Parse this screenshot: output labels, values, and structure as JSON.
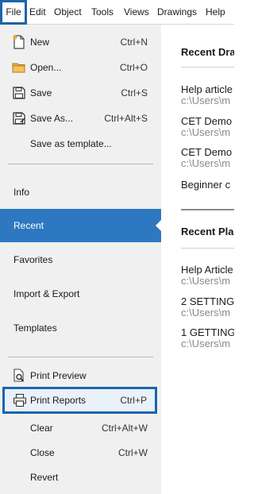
{
  "menubar": {
    "items": [
      "File",
      "Edit",
      "Object",
      "Tools",
      "Views",
      "Drawings",
      "Help"
    ]
  },
  "file_menu": {
    "new": {
      "label": "New",
      "shortcut": "Ctrl+N",
      "icon": "new-file-icon"
    },
    "open": {
      "label": "Open...",
      "shortcut": "Ctrl+O",
      "icon": "folder-icon"
    },
    "save": {
      "label": "Save",
      "shortcut": "Ctrl+S",
      "icon": "save-icon"
    },
    "save_as": {
      "label": "Save As...",
      "shortcut": "Ctrl+Alt+S",
      "icon": "save-as-icon"
    },
    "save_template": {
      "label": "Save as template..."
    },
    "nav": {
      "info": "Info",
      "recent": "Recent",
      "favorites": "Favorites",
      "import_export": "Import & Export",
      "templates": "Templates"
    },
    "print_preview": {
      "label": "Print Preview",
      "icon": "print-preview-icon"
    },
    "print_reports": {
      "label": "Print Reports",
      "shortcut": "Ctrl+P",
      "icon": "printer-icon"
    },
    "clear": {
      "label": "Clear",
      "shortcut": "Ctrl+Alt+W"
    },
    "close": {
      "label": "Close",
      "shortcut": "Ctrl+W"
    },
    "revert": {
      "label": "Revert"
    }
  },
  "recent": {
    "drawings_header": "Recent Dra",
    "drawings": [
      {
        "title": "Help article",
        "path": "c:\\Users\\m"
      },
      {
        "title": "CET Demo",
        "path": "c:\\Users\\m"
      },
      {
        "title": "CET Demo",
        "path": "c:\\Users\\m"
      },
      {
        "title": "Beginner c",
        "path": ""
      }
    ],
    "places_header": "Recent Pla",
    "places": [
      {
        "title": "Help Article",
        "path": "c:\\Users\\m"
      },
      {
        "title": "2 SETTING",
        "path": "c:\\Users\\m"
      },
      {
        "title": "1 GETTING",
        "path": "c:\\Users\\m"
      }
    ]
  },
  "colors": {
    "accent": "#2d78c0",
    "highlight_border": "#1c64a8",
    "panel_bg": "#f0f0f0"
  }
}
